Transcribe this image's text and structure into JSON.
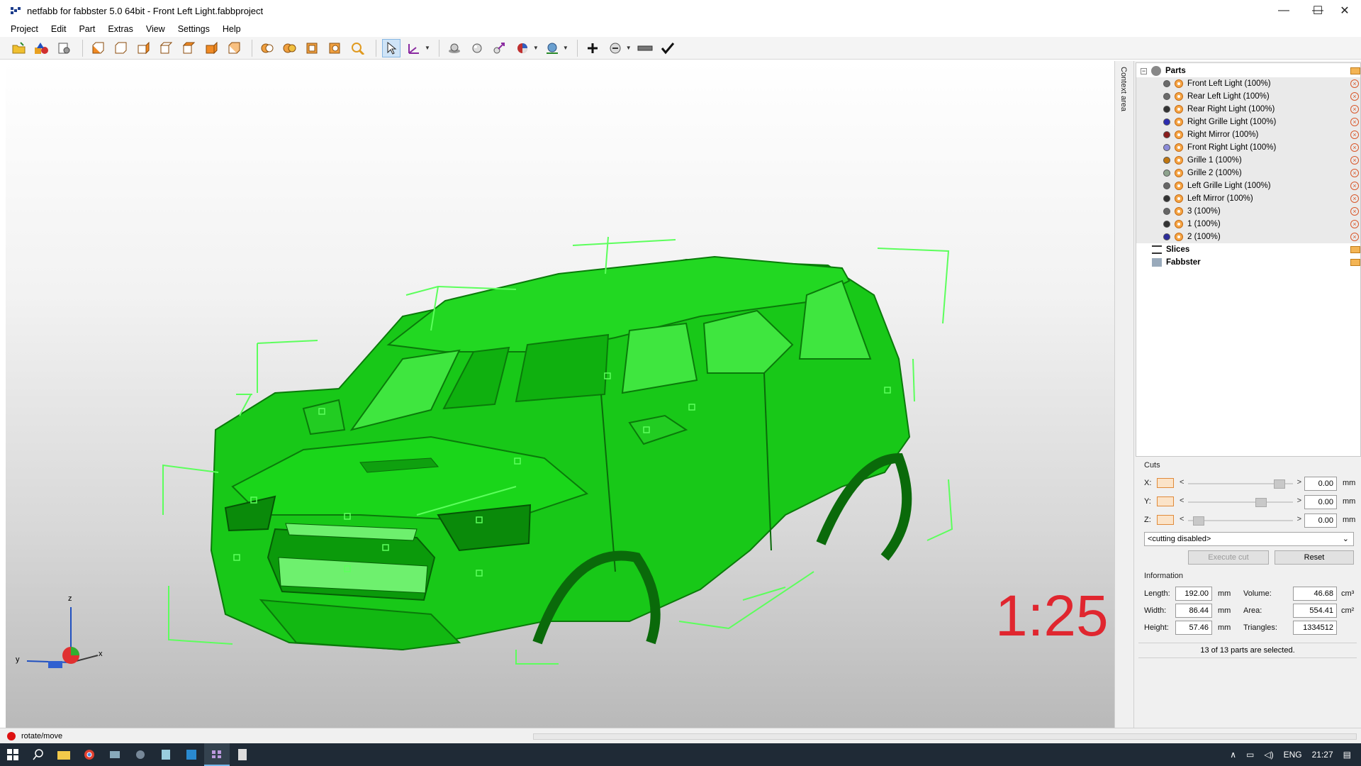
{
  "window": {
    "title": "netfabb for fabbster 5.0 64bit - Front Left Light.fabbproject",
    "minimize": "—",
    "maximize": "☐",
    "close": "✕"
  },
  "menu": [
    "Project",
    "Edit",
    "Part",
    "Extras",
    "View",
    "Settings",
    "Help"
  ],
  "toolbar": {
    "icons": [
      "open-project-icon",
      "add-part-icon",
      "project-settings-icon",
      "view-front-icon",
      "view-back-icon",
      "view-left-icon",
      "view-right-icon",
      "view-top-icon",
      "view-bottom-icon",
      "view-iso-icon",
      "zoom-parts-icon",
      "zoom-all-icon",
      "zoom-platform-icon",
      "zoom-selection-icon",
      "zoom-magnifier-icon",
      "select-pointer-icon",
      "move-axes-icon",
      "shading-icon",
      "lighting-icon",
      "measure-icon",
      "color-wheel-icon",
      "visibility-icon",
      "add-icon",
      "repair-icon",
      "ruler-icon",
      "check-icon"
    ]
  },
  "viewport": {
    "scale_text": "1:25",
    "axes": {
      "x": "x",
      "y": "y",
      "z": "z"
    },
    "model_color": "#1fd61f",
    "bbox_color": "#5cff5c"
  },
  "sidebar": {
    "context_label": "Context area"
  },
  "tree": {
    "root_label": "Parts",
    "parts": [
      {
        "name": "Front Left Light (100%)",
        "color": "#6b6b6b"
      },
      {
        "name": "Rear Left Light (100%)",
        "color": "#6b6b6b"
      },
      {
        "name": "Rear Right Light (100%)",
        "color": "#333333"
      },
      {
        "name": "Right Grille Light (100%)",
        "color": "#2d2db0"
      },
      {
        "name": "Right Mirror (100%)",
        "color": "#8a1e1e"
      },
      {
        "name": "Front Right Light (100%)",
        "color": "#8c8cd9"
      },
      {
        "name": "Grille 1 (100%)",
        "color": "#c0760f"
      },
      {
        "name": "Grille 2 (100%)",
        "color": "#8ea38e"
      },
      {
        "name": "Left Grille Light (100%)",
        "color": "#666666"
      },
      {
        "name": "Left Mirror (100%)",
        "color": "#333333"
      },
      {
        "name": "3 (100%)",
        "color": "#666666"
      },
      {
        "name": "1 (100%)",
        "color": "#333333"
      },
      {
        "name": "2 (100%)",
        "color": "#2d2d9a"
      }
    ],
    "slices_label": "Slices",
    "fabbster_label": "Fabbster"
  },
  "cuts": {
    "title": "Cuts",
    "x_label": "X:",
    "y_label": "Y:",
    "z_label": "Z:",
    "x_value": "0.00",
    "y_value": "0.00",
    "z_value": "0.00",
    "x_level": 0.92,
    "y_level": 0.72,
    "z_level": 0.05,
    "unit": "mm",
    "mode": "<cutting disabled>",
    "execute_label": "Execute cut",
    "reset_label": "Reset"
  },
  "info": {
    "title": "Information",
    "length_label": "Length:",
    "length": "192.00",
    "width_label": "Width:",
    "width": "86.44",
    "height_label": "Height:",
    "height": "57.46",
    "unit": "mm",
    "volume_label": "Volume:",
    "volume": "46.68",
    "area_label": "Area:",
    "area": "554.41",
    "triangles_label": "Triangles:",
    "triangles": "1334512",
    "volume_unit": "cm³",
    "area_unit": "cm²",
    "selection": "13 of 13 parts are selected."
  },
  "status": {
    "text": "rotate/move"
  },
  "taskbar": {
    "lang": "ENG",
    "time": "21:27"
  }
}
